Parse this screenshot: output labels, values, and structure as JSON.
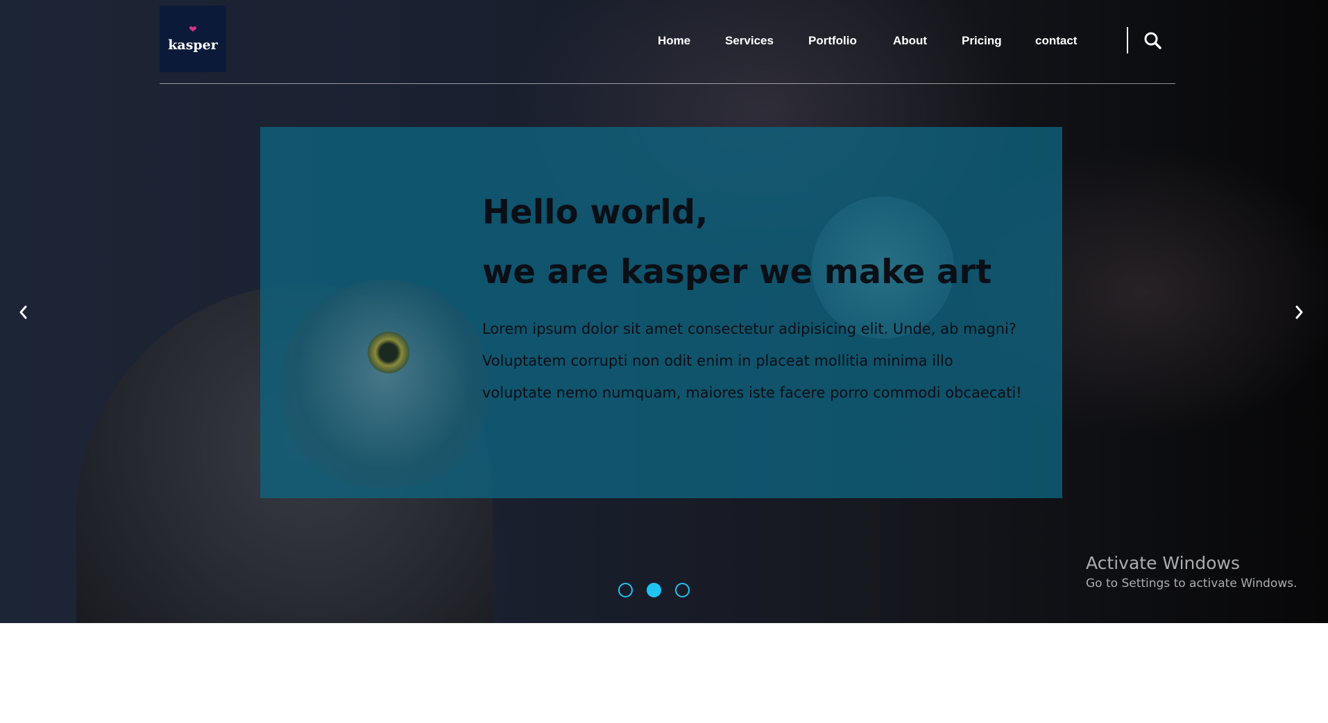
{
  "brand": {
    "name": "kasper",
    "icon": "lips-icon",
    "bg_color": "#0c1a3a",
    "accent": "#d63384"
  },
  "nav": {
    "items": [
      {
        "label": "Home"
      },
      {
        "label": "Services"
      },
      {
        "label": "Portfolio"
      },
      {
        "label": "About"
      },
      {
        "label": "Pricing"
      },
      {
        "label": "contact"
      }
    ],
    "search_icon": "search-icon"
  },
  "slider": {
    "title_line_1": "Hello world,",
    "title_line_2": "we are kasper we make art",
    "text": "Lorem ipsum dolor sit amet consectetur adipisicing elit. Unde, ab magni? Voluptatem corrupti non odit enim in placeat mollitia minima illo voluptate nemo numquam, maiores iste facere porro commodi obcaecati!",
    "prev_icon": "chevron-left-icon",
    "next_icon": "chevron-right-icon",
    "slide_count": 3,
    "active_slide": 2,
    "overlay_color": "#0e6480",
    "dot_color": "#1fc4f2"
  },
  "watermark": {
    "title": "Activate Windows",
    "subtitle": "Go to Settings to activate Windows."
  }
}
